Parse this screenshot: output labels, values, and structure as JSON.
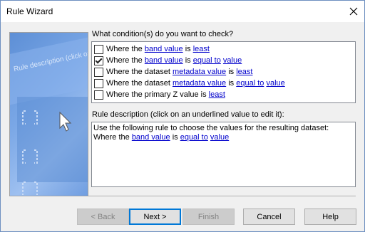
{
  "window": {
    "title": "Rule Wizard"
  },
  "art": {
    "label": "Rule description (click on a"
  },
  "conditions": {
    "heading": "What condition(s) do you want to check?",
    "items": [
      {
        "checked": false,
        "parts": [
          {
            "text": "Where the ",
            "link": false
          },
          {
            "text": "band value",
            "link": true
          },
          {
            "text": " is ",
            "link": false
          },
          {
            "text": "least",
            "link": true
          }
        ]
      },
      {
        "checked": true,
        "parts": [
          {
            "text": "Where the ",
            "link": false
          },
          {
            "text": "band value",
            "link": true
          },
          {
            "text": " is ",
            "link": false
          },
          {
            "text": "equal to",
            "link": true
          },
          {
            "text": " ",
            "link": false
          },
          {
            "text": "value",
            "link": true
          }
        ]
      },
      {
        "checked": false,
        "parts": [
          {
            "text": "Where the dataset ",
            "link": false
          },
          {
            "text": "metadata value",
            "link": true
          },
          {
            "text": " is ",
            "link": false
          },
          {
            "text": "least",
            "link": true
          }
        ]
      },
      {
        "checked": false,
        "parts": [
          {
            "text": "Where the dataset ",
            "link": false
          },
          {
            "text": "metadata value",
            "link": true
          },
          {
            "text": " is ",
            "link": false
          },
          {
            "text": "equal to",
            "link": true
          },
          {
            "text": " ",
            "link": false
          },
          {
            "text": "value",
            "link": true
          }
        ]
      },
      {
        "checked": false,
        "parts": [
          {
            "text": "Where the primary Z value is ",
            "link": false
          },
          {
            "text": "least",
            "link": true
          }
        ]
      }
    ]
  },
  "description": {
    "heading": "Rule description (click on an underlined value to edit it):",
    "line1": "Use the following rule to choose the values for the resulting dataset:",
    "line2": [
      {
        "text": "Where the ",
        "link": false
      },
      {
        "text": "band value",
        "link": true
      },
      {
        "text": " is ",
        "link": false
      },
      {
        "text": "equal to",
        "link": true
      },
      {
        "text": " ",
        "link": false
      },
      {
        "text": "value",
        "link": true
      }
    ]
  },
  "buttons": {
    "back": "< Back",
    "next": "Next >",
    "finish": "Finish",
    "cancel": "Cancel",
    "help": "Help"
  }
}
